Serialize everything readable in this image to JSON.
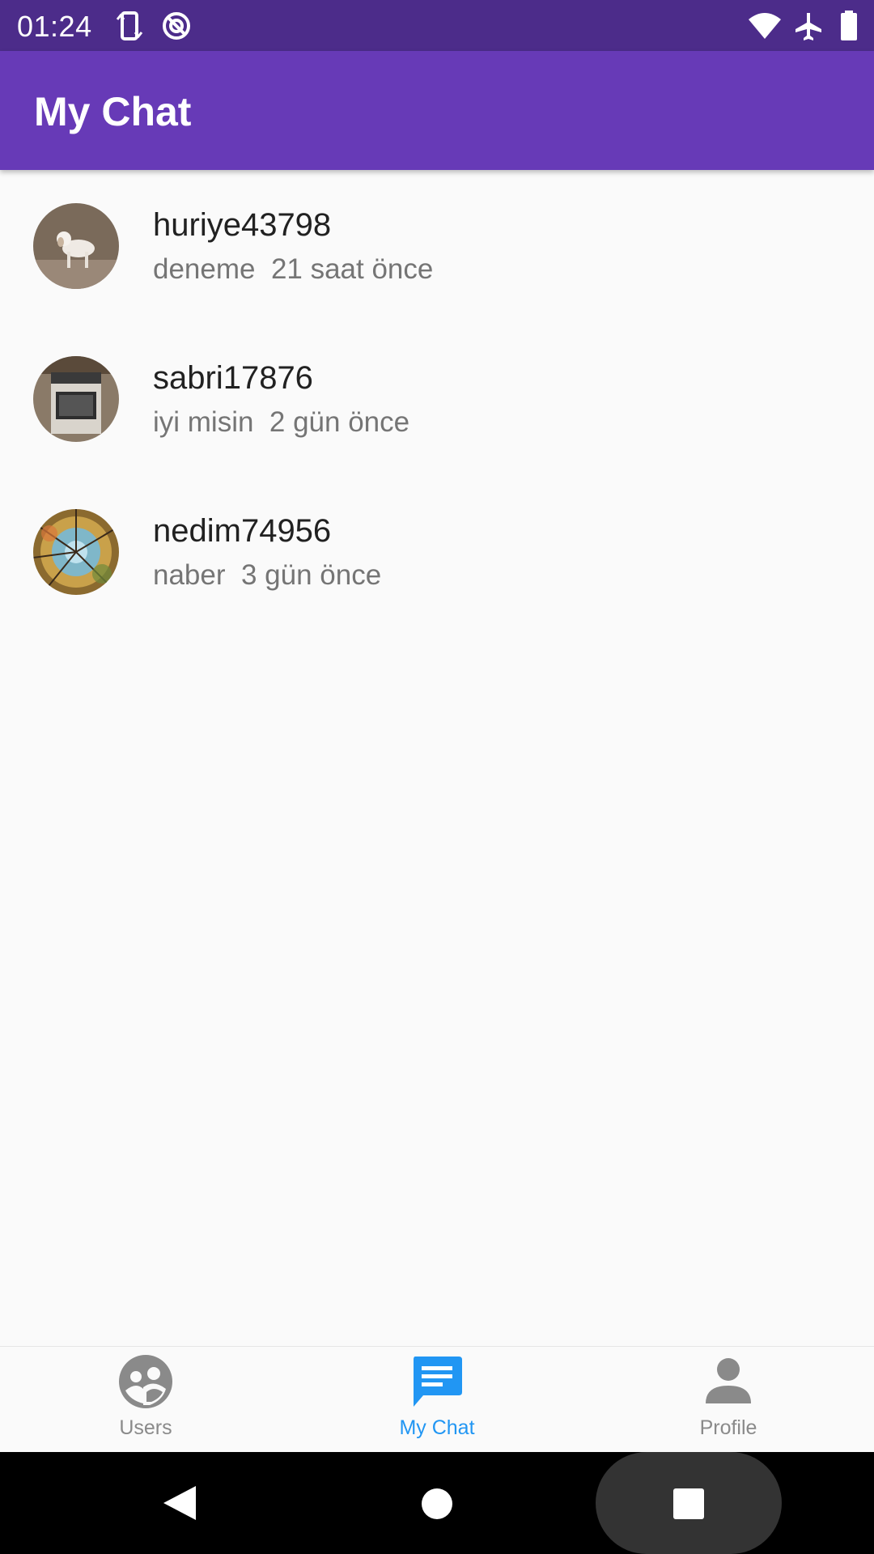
{
  "status_bar": {
    "time": "01:24",
    "left_icons": [
      "screen-rotate-icon",
      "do-not-disturb-icon"
    ],
    "right_icons": [
      "wifi-icon",
      "airplane-icon",
      "battery-icon"
    ]
  },
  "app_bar": {
    "title": "My Chat"
  },
  "chats": [
    {
      "name": "huriye43798",
      "last_message": "deneme",
      "time_ago": "21 saat önce",
      "avatar": "dog photo"
    },
    {
      "name": "sabri17876",
      "last_message": "iyi misin",
      "time_ago": "2 gün önce",
      "avatar": "oven photo"
    },
    {
      "name": "nedim74956",
      "last_message": "naber",
      "time_ago": "3 gün önce",
      "avatar": "forest canopy photo"
    }
  ],
  "bottom_nav": {
    "items": [
      {
        "label": "Users",
        "icon": "users-icon",
        "active": false
      },
      {
        "label": "My Chat",
        "icon": "chat-icon",
        "active": true
      },
      {
        "label": "Profile",
        "icon": "profile-icon",
        "active": false
      }
    ]
  },
  "colors": {
    "status_bar": "#4c2c8a",
    "app_bar": "#673ab7",
    "active_nav": "#2196f3",
    "inactive_nav": "#8a8a8a"
  }
}
